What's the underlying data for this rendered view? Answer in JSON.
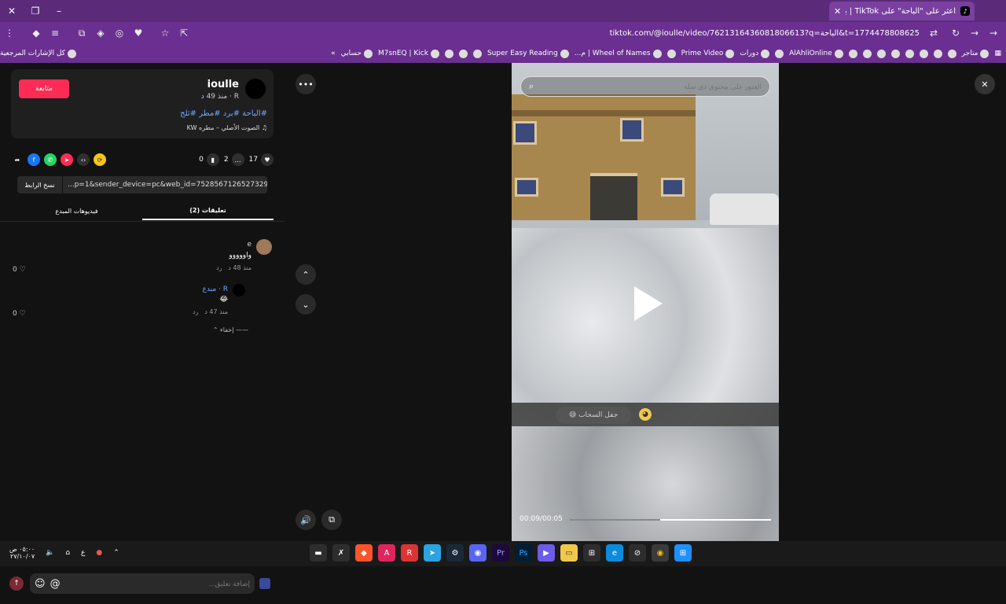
{
  "browser": {
    "tab_title": "اعثر على \"الباحة\" على TikTok | بد...",
    "tab_favicon": "TikTok",
    "new_tab": "+",
    "tab_close": "✕",
    "url": "tiktok.com/@ioulle/video/7621316436081806613?q=الباحة&t=1774478808625",
    "bookmarks": [
      "متاجر",
      "AlAhliOnline",
      "دورات",
      "Prime Video",
      "Wheel of Names | م...",
      "Super Easy Reading",
      "M7snEQ | Kick",
      "حسابي",
      "كل الإشارات المرجعية"
    ],
    "bookmarks_overflow": "»"
  },
  "post": {
    "follow_label": "متابعة",
    "username": "ioulle",
    "subline": "R · منذ 49 د",
    "hashtags": "#الباحة #برد #مطر #ثلج",
    "music": "الصوت الأصلي – مطره KW",
    "likes": "17",
    "comments": "2",
    "saves": "0",
    "copy_link_label": "نسخ الرابط",
    "link_text": "...p=1&sender_device=pc&web_id=7528567126527329810",
    "tab_comments": "تعليقات (2)",
    "tab_creator_videos": "فيديوهات المبدع"
  },
  "comments": [
    {
      "author": "e",
      "text": "واووووو",
      "time": "منذ 48 د",
      "reply": "رد",
      "likes": "0"
    },
    {
      "author": "R · مبدع",
      "text": "😂",
      "time": "منذ 47 د",
      "reply": "رد",
      "likes": "0"
    }
  ],
  "hide_replies": "إخفاء",
  "comment_input_placeholder": "إضافة تعليق...",
  "player": {
    "search_placeholder": "العثور على محتوى ذي صلة",
    "sticker_text": "جفل السحاب 😅",
    "time": "00:09/00:05",
    "progress": 0.55
  },
  "system": {
    "clock_time": "٠٥:٠٠ ص",
    "clock_date": "٢٧/١٠/٠٧",
    "lang": "ع"
  },
  "colors": {
    "accent": "#fe2c55",
    "browser": "#6a2f90",
    "link": "#6ea8fe"
  }
}
